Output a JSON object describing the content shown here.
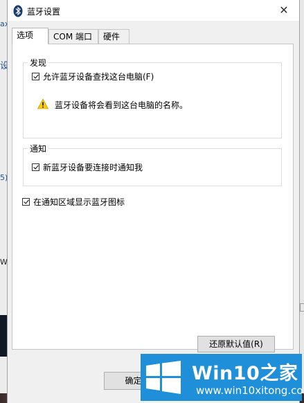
{
  "window": {
    "title": "蓝牙设置"
  },
  "tabs": [
    {
      "label": "选项"
    },
    {
      "label": "COM 端口"
    },
    {
      "label": "硬件"
    }
  ],
  "discovery": {
    "title": "发现",
    "allow_label": "允许蓝牙设备查找这台电脑(F)",
    "warning": "蓝牙设备将会看到这台电脑的名称。"
  },
  "notify": {
    "title": "通知",
    "label": "新蓝牙设备要连接时通知我"
  },
  "tray_icon_label": "在通知区域显示蓝牙图标",
  "buttons": {
    "restore": "还原默认值(R)",
    "ok": "确定"
  },
  "background": {
    "frag1": "ax",
    "frag2": "设",
    "frag3": "5)",
    "frag4": "Wi"
  },
  "watermark": {
    "brand": "Win10之家",
    "url": "www.win10xitong.com"
  }
}
